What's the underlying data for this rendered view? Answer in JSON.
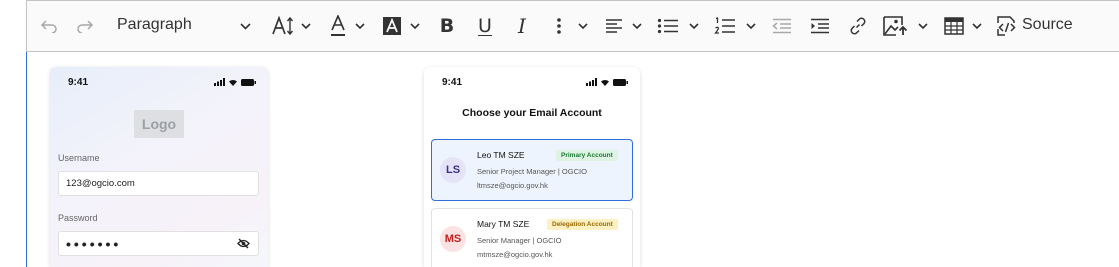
{
  "toolbar": {
    "paragraph_label": "Paragraph",
    "source_label": "Source",
    "bold_glyph": "B",
    "underline_glyph": "U",
    "italic_glyph": "I"
  },
  "login_screen": {
    "time": "9:41",
    "logo_text": "Logo",
    "username_label": "Username",
    "username_value": "123@ogcio.com",
    "password_label": "Password",
    "password_value": "•••••••"
  },
  "choose_screen": {
    "time": "9:41",
    "title": "Choose your Email Account",
    "accounts": [
      {
        "initials": "LS",
        "name": "Leo TM SZE",
        "badge": "Primary Account",
        "role": "Senior Project Manager | OGCIO",
        "email": "ltmsze@ogcio.gov.hk"
      },
      {
        "initials": "MS",
        "name": "Mary TM SZE",
        "badge": "Delegation Account",
        "role": "Senior Manager | OGCIO",
        "email": "mtmsze@ogcio.gov.hk"
      }
    ]
  },
  "colors": {
    "accent": "#2f6fdc",
    "primary_badge_bg": "#dff3e3",
    "delegation_badge_bg": "#fdf0c2",
    "ls_avatar": "#3b2f8a",
    "ms_avatar": "#c41e1e"
  }
}
